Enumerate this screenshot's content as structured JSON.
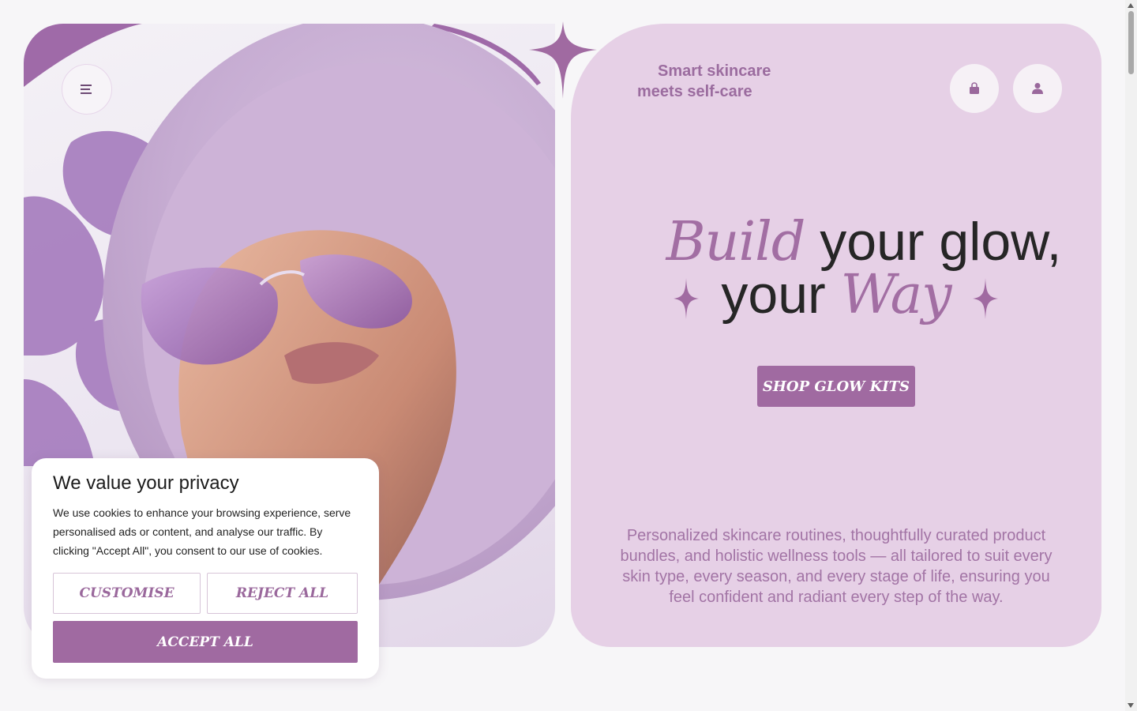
{
  "header": {
    "tagline_line1": "Smart skincare",
    "tagline_line2": "meets self-care"
  },
  "icons": {
    "menu": "hamburger-icon",
    "bag": "shopping-bag-icon",
    "account": "user-icon",
    "decor": "four-point-star-icon"
  },
  "hero": {
    "headline_word1": "Build",
    "headline_rest1": " your glow,",
    "headline_word2": "your ",
    "headline_word3": "Way",
    "cta_label": "SHOP GLOW KITS",
    "description": "Personalized skincare routines, thoughtfully curated product bundles, and holistic wellness tools — all tailored to suit every skin type, every season, and every stage of life, ensuring you feel confident and radiant every step of the way."
  },
  "cookie_banner": {
    "title": "We value your privacy",
    "text": "We use cookies to enhance your browsing experience, serve personalised ads or content, and analyse our traffic. By clicking \"Accept All\", you consent to our use of cookies.",
    "customise_label": "CUSTOMISE",
    "reject_label": "REJECT ALL",
    "accept_label": "ACCEPT ALL"
  },
  "colors": {
    "accent": "#a06aa1",
    "panel": "#e6d0e6",
    "background": "#f7f6f8",
    "text_dark": "#262626"
  }
}
